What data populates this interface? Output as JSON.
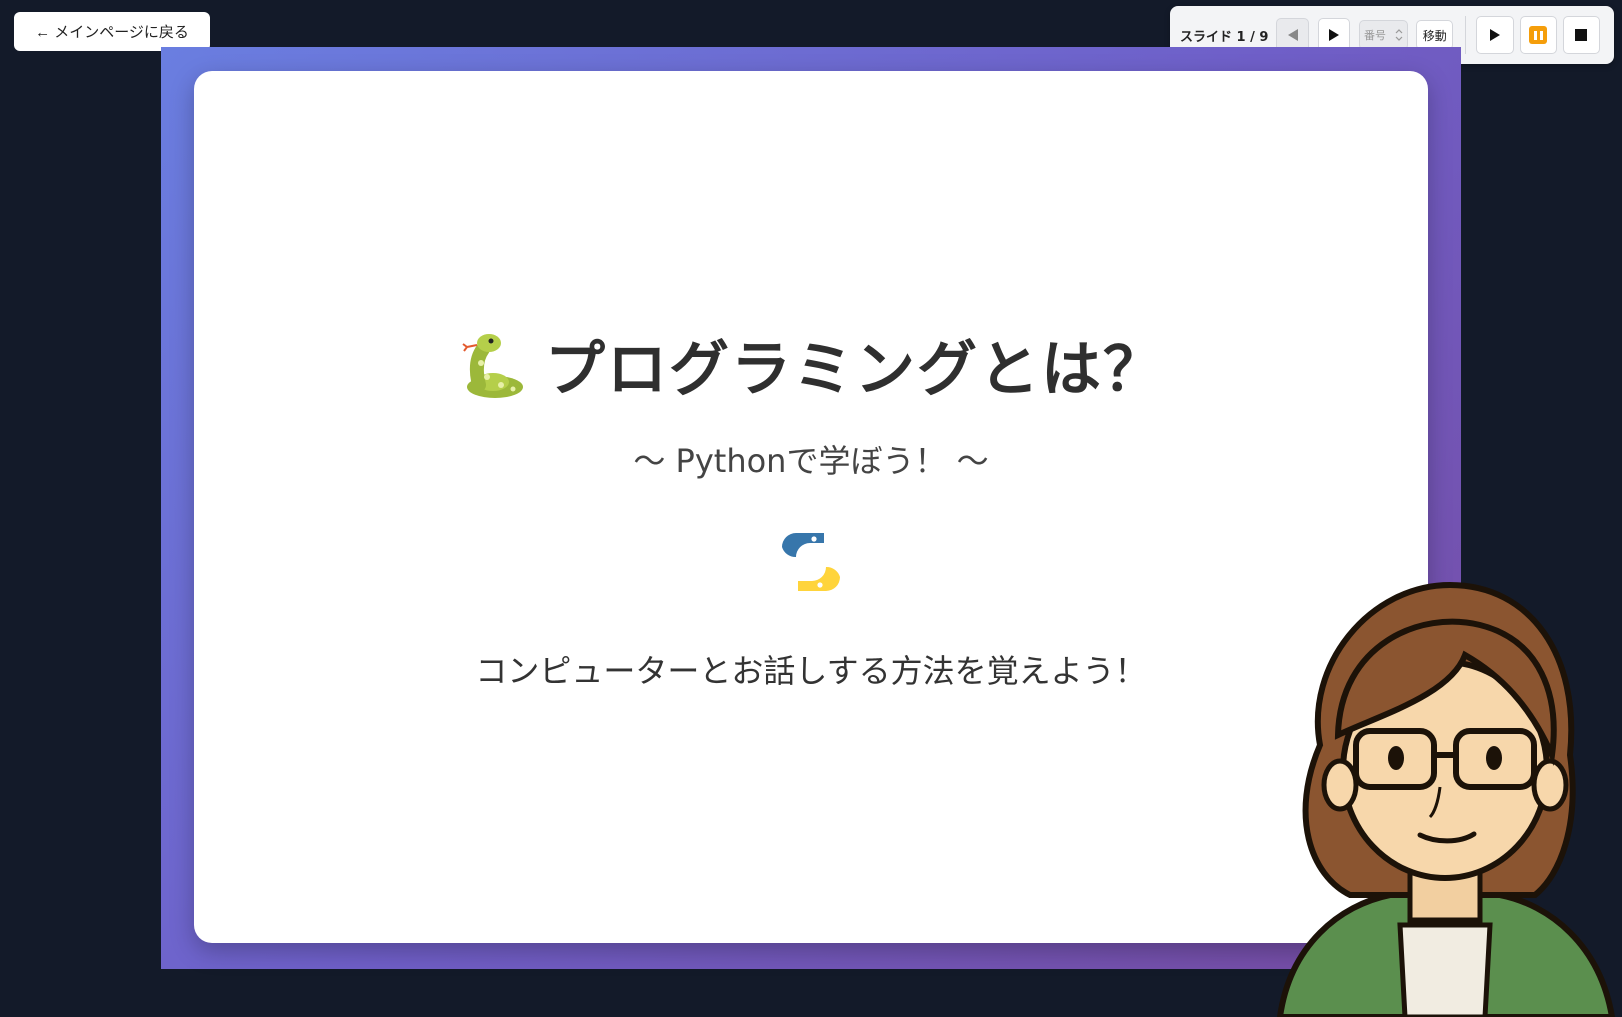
{
  "back_button": {
    "label": "← メインページに戻る"
  },
  "controls": {
    "counter": "スライド 1 / 9",
    "number_placeholder": "番号",
    "go_label": "移動",
    "accent": "#f59e0b"
  },
  "slide": {
    "title": "プログラミングとは？",
    "subtitle": "〜 Pythonで学ぼう！ 〜",
    "tagline": "コンピューターとお話しする方法を覚えよう！",
    "title_icon": "snake-icon",
    "logo_icon": "python-logo-icon",
    "gradient": [
      "#667eea",
      "#764ba2"
    ]
  }
}
